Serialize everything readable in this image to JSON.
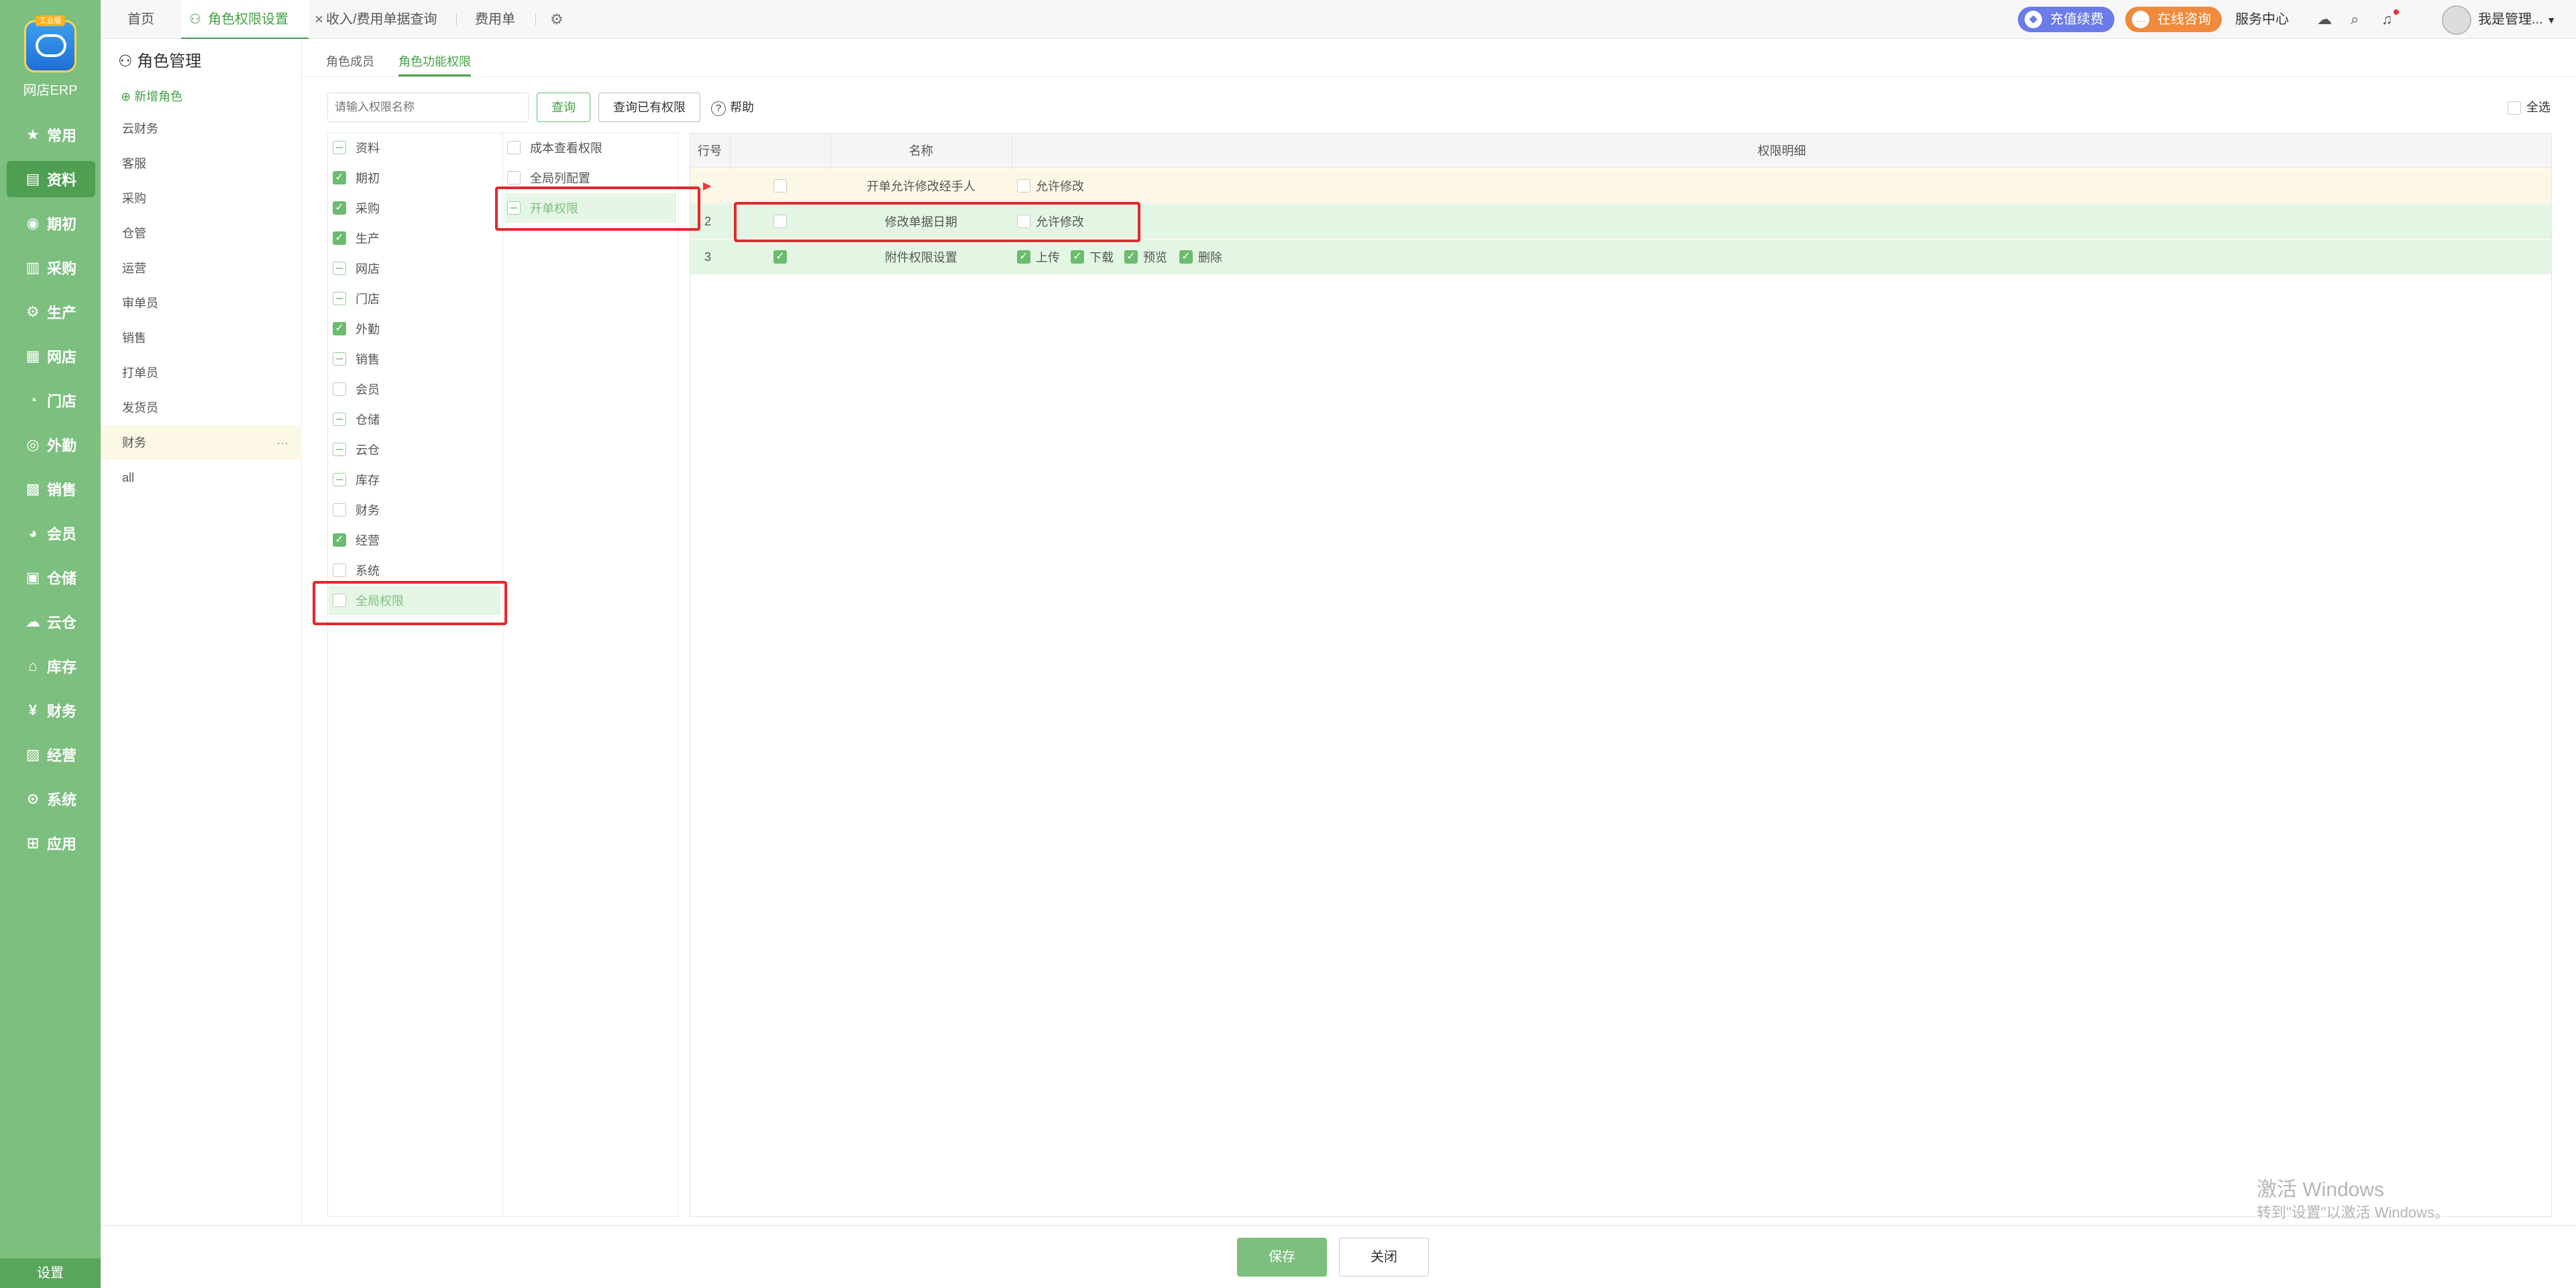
{
  "nav": {
    "logo_badge": "工业版",
    "logo_text": "网店ERP",
    "items": [
      {
        "label": "常用",
        "icon": "★"
      },
      {
        "label": "资料",
        "icon": "▤"
      },
      {
        "label": "期初",
        "icon": "◉"
      },
      {
        "label": "采购",
        "icon": "▥"
      },
      {
        "label": "生产",
        "icon": "⚙"
      },
      {
        "label": "网店",
        "icon": "▦"
      },
      {
        "label": "门店",
        "icon": "◔"
      },
      {
        "label": "外勤",
        "icon": "◎"
      },
      {
        "label": "销售",
        "icon": "▩"
      },
      {
        "label": "会员",
        "icon": "◕"
      },
      {
        "label": "仓储",
        "icon": "▣"
      },
      {
        "label": "云仓",
        "icon": "☁"
      },
      {
        "label": "库存",
        "icon": "⌂"
      },
      {
        "label": "财务",
        "icon": "¥"
      },
      {
        "label": "经营",
        "icon": "▨"
      },
      {
        "label": "系统",
        "icon": "⊙"
      },
      {
        "label": "应用",
        "icon": "⊞"
      }
    ],
    "settings": "设置"
  },
  "tabs": {
    "home": "首页",
    "active": "角色权限设置",
    "income": "收入/费用单据查询",
    "expense": "费用单"
  },
  "header": {
    "recharge": "充值续费",
    "consult": "在线咨询",
    "service": "服务中心",
    "user": "我是管理..."
  },
  "roles": {
    "title": "角色管理",
    "add": "新增角色",
    "list": [
      "云财务",
      "客服",
      "采购",
      "仓管",
      "运营",
      "审单员",
      "销售",
      "打单员",
      "发货员",
      "财务",
      "all"
    ]
  },
  "subtabs": {
    "members": "角色成员",
    "perms": "角色功能权限"
  },
  "search": {
    "placeholder": "请输入权限名称",
    "query": "查询",
    "query_owned": "查询已有权限",
    "help": "帮助",
    "select_all": "全选"
  },
  "tree1": [
    "资料",
    "期初",
    "采购",
    "生产",
    "网店",
    "门店",
    "外勤",
    "销售",
    "会员",
    "仓储",
    "云仓",
    "库存",
    "财务",
    "经营",
    "系统",
    "全局权限"
  ],
  "tree2": [
    "成本查看权限",
    "全局列配置",
    "开单权限"
  ],
  "table": {
    "headers": {
      "row": "行号",
      "name": "名称",
      "detail": "权限明细"
    },
    "rows": [
      {
        "no": "",
        "name": "开单允许修改经手人",
        "details": [
          "允许修改"
        ]
      },
      {
        "no": "2",
        "name": "修改单据日期",
        "details": [
          "允许修改"
        ]
      },
      {
        "no": "3",
        "name": "附件权限设置",
        "details": [
          "上传",
          "下载",
          "预览",
          "删除"
        ]
      }
    ]
  },
  "footer": {
    "save": "保存",
    "close": "关闭"
  },
  "watermark": {
    "line1": "激活 Windows",
    "line2": "转到\"设置\"以激活 Windows。"
  }
}
